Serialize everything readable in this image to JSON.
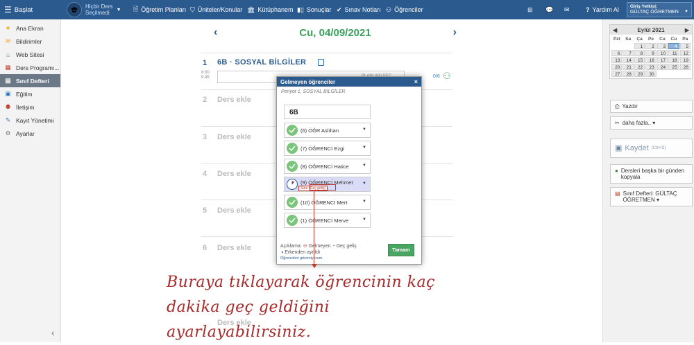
{
  "topbar": {
    "start": "Başlat",
    "course_line1": "Hiçbir Ders",
    "course_line2": "Seçilmedi",
    "nav": [
      "Öğretim Planları",
      "Üniteler/Konular",
      "Kütüphanem",
      "Sonuçlar",
      "Sınav Notları",
      "Öğrenciler"
    ],
    "help": "Yardım Al",
    "login_label": "Giriş Yetkisi:",
    "login_user": "GÜLTAÇ ÖĞRETMEN"
  },
  "sidebar": {
    "items": [
      {
        "label": "Ana Ekran",
        "icon": "star-icon"
      },
      {
        "label": "Bildirimler",
        "icon": "envelope-icon"
      },
      {
        "label": "Web Sitesi",
        "icon": "home-icon"
      },
      {
        "label": "Ders Programı...",
        "icon": "schedule-icon"
      },
      {
        "label": "Sınıf Defteri",
        "icon": "notebook-icon"
      },
      {
        "label": "Eğitim",
        "icon": "briefcase-icon"
      },
      {
        "label": "İletişim",
        "icon": "people-icon"
      },
      {
        "label": "Kayıt Yönetimi",
        "icon": "pencil-icon"
      },
      {
        "label": "Ayarlar",
        "icon": "gear-icon"
      }
    ],
    "collapse": "‹"
  },
  "main": {
    "date_title": "Cu, 04/09/2021",
    "prev": "‹",
    "next": "›",
    "period1": {
      "num": "1",
      "title": "6B · SOSYAL BİLGİLER",
      "time_start": "8:00",
      "time_end": "9:45",
      "plan": "PLANLARI SEÇ",
      "count": "0/6"
    },
    "periods": [
      {
        "num": "2",
        "label": "Ders ekle"
      },
      {
        "num": "3",
        "label": "Ders ekle"
      },
      {
        "num": "4",
        "label": "Ders ekle"
      },
      {
        "num": "5",
        "label": "Ders ekle"
      },
      {
        "num": "6",
        "label": "Ders ekle"
      },
      {
        "num": "",
        "label": "Ders ekle"
      }
    ]
  },
  "calendar": {
    "month": "Eylül 2021",
    "day_headers": [
      "Pzt",
      "Sa",
      "Ça",
      "Pe",
      "Cu",
      "Cu",
      "Pa"
    ],
    "weeks": [
      [
        {
          "d": "",
          "o": false
        },
        {
          "d": "",
          "o": false
        },
        {
          "d": "1",
          "o": false
        },
        {
          "d": "2",
          "o": false
        },
        {
          "d": "3",
          "o": false
        },
        {
          "d": "4",
          "o": false,
          "sel": true
        },
        {
          "d": "5",
          "o": false
        }
      ],
      [
        {
          "d": "6"
        },
        {
          "d": "7"
        },
        {
          "d": "8"
        },
        {
          "d": "9"
        },
        {
          "d": "10"
        },
        {
          "d": "11"
        },
        {
          "d": "12"
        }
      ],
      [
        {
          "d": "13"
        },
        {
          "d": "14"
        },
        {
          "d": "15"
        },
        {
          "d": "16"
        },
        {
          "d": "17"
        },
        {
          "d": "18"
        },
        {
          "d": "19"
        }
      ],
      [
        {
          "d": "20"
        },
        {
          "d": "21"
        },
        {
          "d": "22"
        },
        {
          "d": "23"
        },
        {
          "d": "24"
        },
        {
          "d": "25"
        },
        {
          "d": "26"
        }
      ],
      [
        {
          "d": "27"
        },
        {
          "d": "28"
        },
        {
          "d": "29"
        },
        {
          "d": "30"
        },
        {
          "d": ""
        },
        {
          "d": ""
        },
        {
          "d": ""
        }
      ]
    ]
  },
  "right_buttons": {
    "print": "Yazdır",
    "more": "daha fazla.. ▾",
    "save": "Kaydet",
    "save_hint": "(Ctrl+S)",
    "copy": "Dersleri başka bir günden kopyala",
    "class_book": "Sınıf Defteri: GÜLTAÇ ÖĞRETMEN ▾"
  },
  "modal": {
    "title": "Gelmeyen öğrenciler",
    "close": "×",
    "subtitle": "Periyot 1, SOSYAL BİLGİLER",
    "class_name": "6B",
    "students": [
      {
        "label": "(6) ÖĞR Aslıhan",
        "late": false
      },
      {
        "label": "(7) ÖĞRENCİ Ezgi",
        "late": false
      },
      {
        "label": "(8) ÖĞRENCİ Hatice",
        "late": false
      },
      {
        "label": "(9) ÖĞRENCİ Mehmet",
        "late": true,
        "badge": "Süre (Geç geliş)"
      },
      {
        "label": "(10) ÖĞRENCİ Mert",
        "late": false
      },
      {
        "label": "(1) ÖĞRENCİ Merve",
        "late": false
      }
    ],
    "legend_prefix": "Açıklama:",
    "legend_absent": "Gelmeyen",
    "legend_late": "Geç geliş",
    "legend_early": "Erkenden ayrıldı",
    "legend_link": "Öğrencileri göremiyorum.",
    "ok": "Tamam"
  },
  "caption": {
    "line1": "Buraya tıklayarak öğrencinin kaç",
    "line2": "dakika geç geldiğini ayarlayabilirsiniz."
  },
  "colors": {
    "topbar": "#2b5a8e",
    "accent_green": "#3aa05c",
    "annotation": "#a82a2a"
  }
}
